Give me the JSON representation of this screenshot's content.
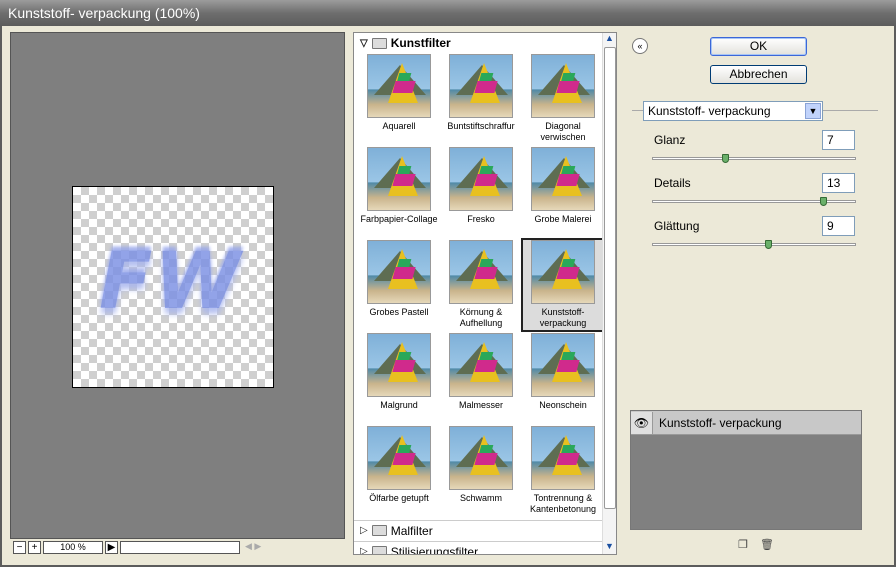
{
  "window": {
    "title": "Kunststoff- verpackung (100%)"
  },
  "preview": {
    "text": "FW",
    "zoom": "100 %",
    "zoom_minus": "−",
    "zoom_plus": "+",
    "zoom_menu": "▶"
  },
  "gallery": {
    "open_category": "Kunstfilter",
    "tiles": [
      {
        "label": "Aquarell"
      },
      {
        "label": "Buntstiftschraffur"
      },
      {
        "label": "Diagonal verwischen"
      },
      {
        "label": "Farbpapier-Collage"
      },
      {
        "label": "Fresko"
      },
      {
        "label": "Grobe Malerei"
      },
      {
        "label": "Grobes Pastell"
      },
      {
        "label": "Körnung & Aufhellung"
      },
      {
        "label": "Kunststoff-verpackung"
      },
      {
        "label": "Malgrund"
      },
      {
        "label": "Malmesser"
      },
      {
        "label": "Neonschein"
      },
      {
        "label": "Ölfarbe getupft"
      },
      {
        "label": "Schwamm"
      },
      {
        "label": "Tontrennung & Kantenbetonung"
      }
    ],
    "selected_index": 8,
    "closed_categories": [
      "Malfilter",
      "Stilisierungsfilter"
    ]
  },
  "buttons": {
    "ok": "OK",
    "cancel": "Abbrechen",
    "collapse": "«"
  },
  "settings": {
    "filter_select": "Kunststoff- verpackung",
    "params": [
      {
        "label": "Glanz",
        "value": "7",
        "level": 0.35
      },
      {
        "label": "Details",
        "value": "13",
        "level": 0.85
      },
      {
        "label": "Glättung",
        "value": "9",
        "level": 0.57
      }
    ]
  },
  "layers": {
    "active": "Kunststoff- verpackung"
  },
  "colors": {
    "accent": "#3c67d8",
    "title_bar": "#6e6e6e",
    "preview_bg": "#7f7f7f",
    "text_color": "#7f93e4"
  }
}
